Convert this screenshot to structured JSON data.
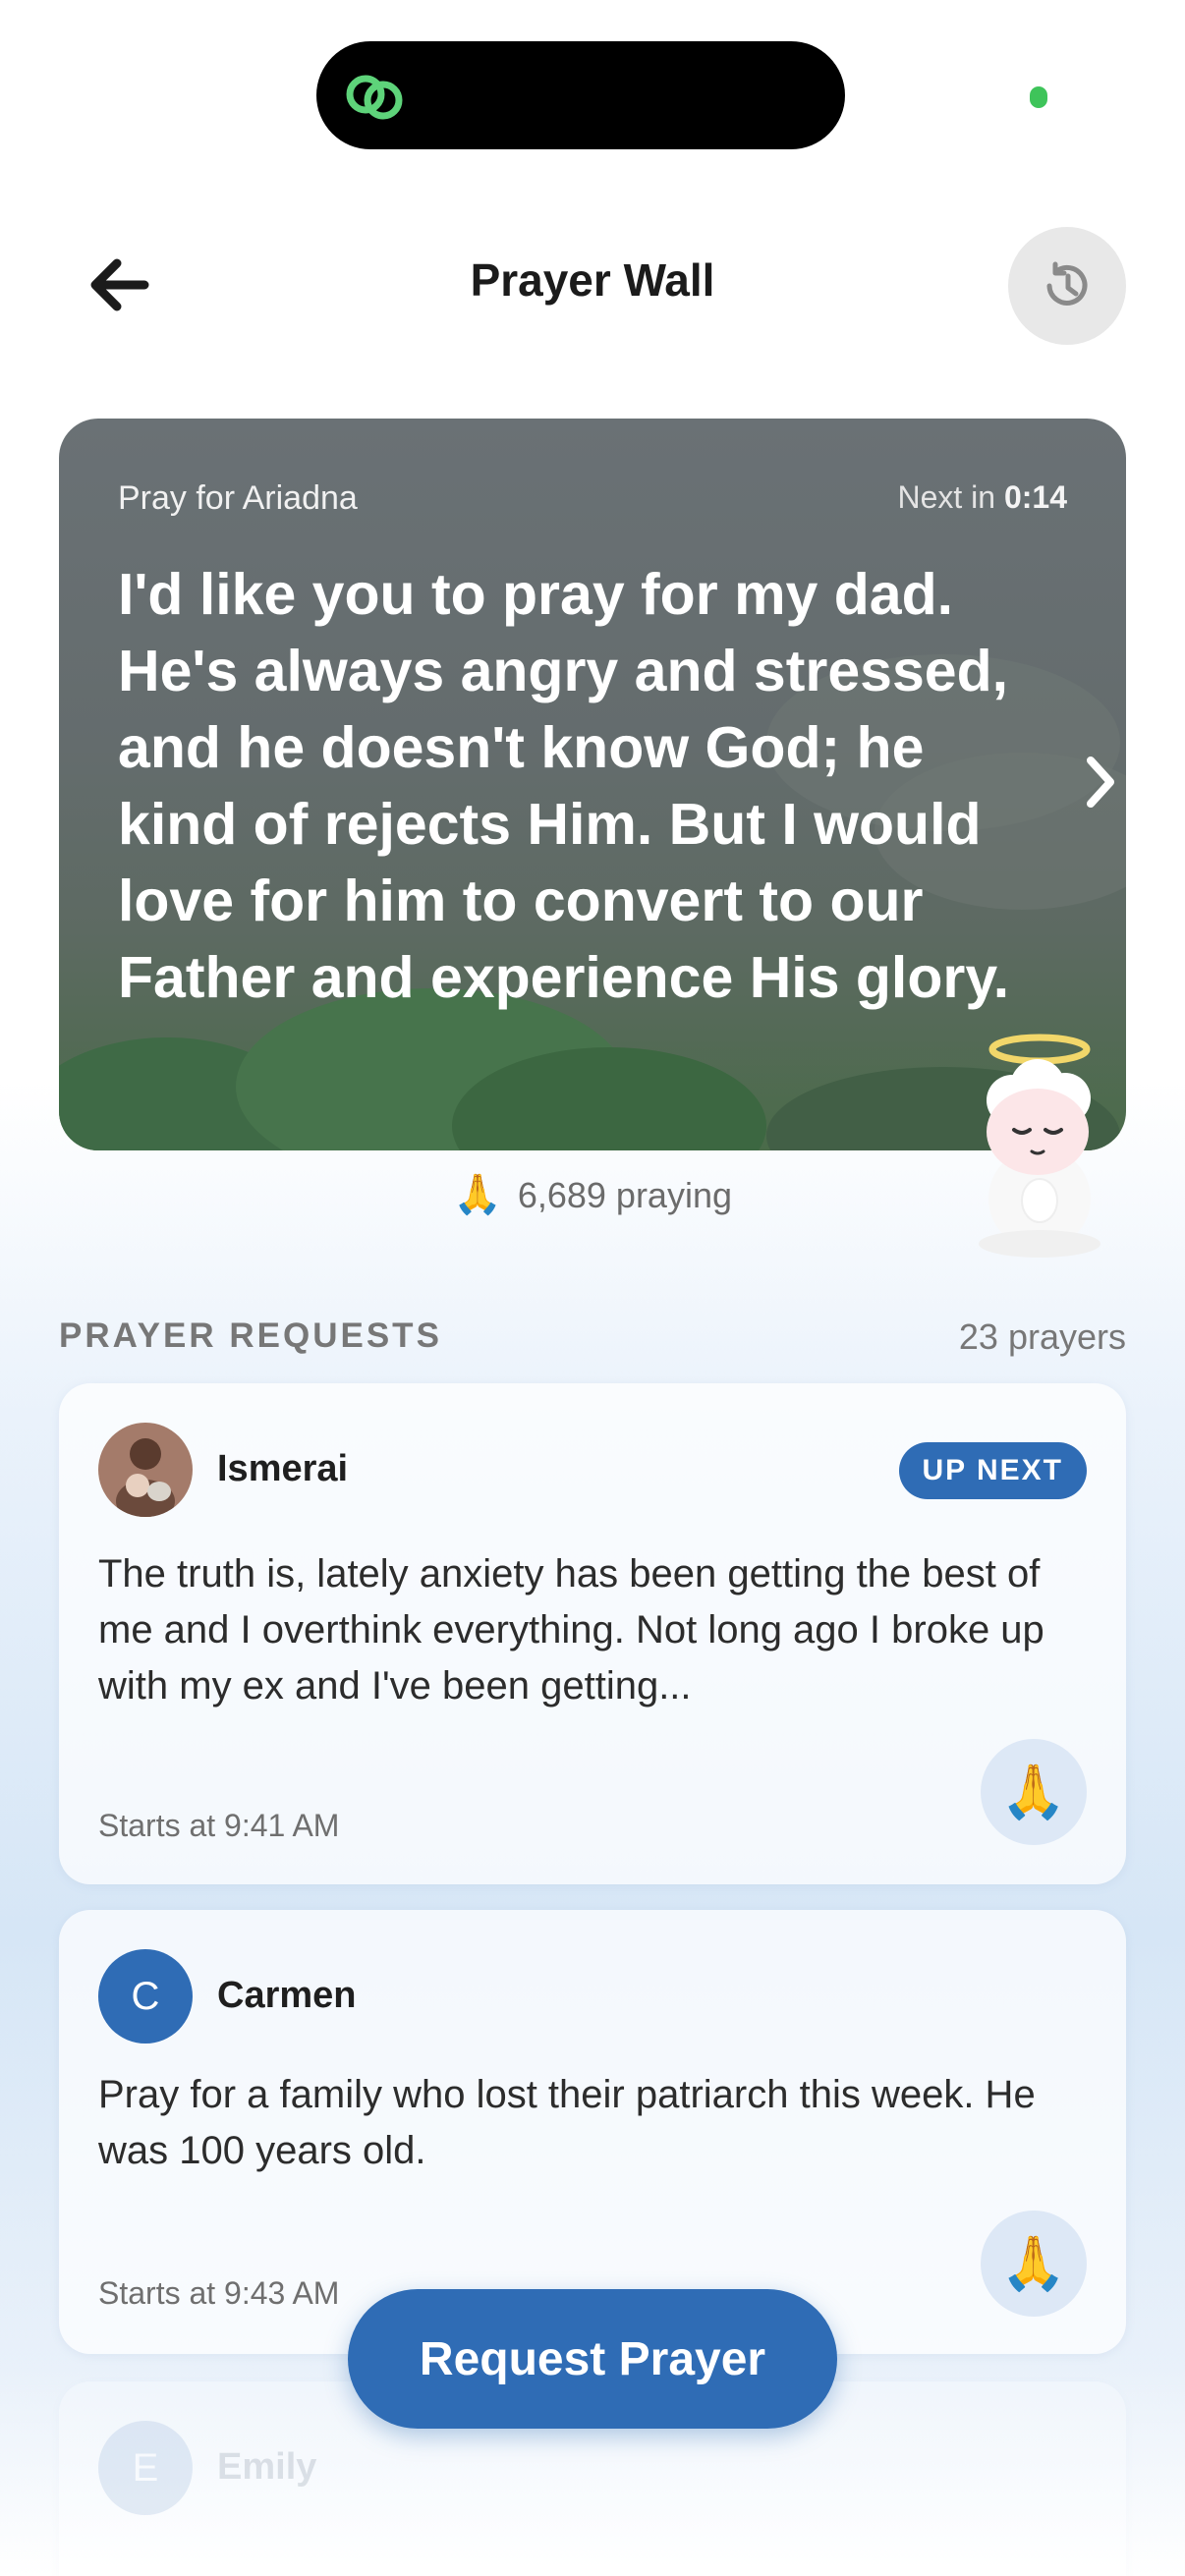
{
  "header": {
    "title": "Prayer Wall"
  },
  "featured": {
    "label": "Pray for Ariadna",
    "next_prefix": "Next in",
    "next_time": "0:14",
    "text": "I'd like you to pray for my dad. He's always angry and stressed, and he doesn't know God; he kind of rejects Him. But I would love for him to convert to our Father and experience His glory.",
    "praying_icon": "🙏",
    "praying_count": "6,689 praying"
  },
  "section": {
    "title": "PRAYER REQUESTS",
    "count": "23 prayers"
  },
  "requests": [
    {
      "name": "Ismerai",
      "badge": "UP NEXT",
      "text": "The truth is, lately anxiety has been getting the best of me and I overthink everything. Not long ago I broke up with my ex and I've been getting...",
      "starts": "Starts at 9:41 AM",
      "pray_icon": "🙏"
    },
    {
      "name": "Carmen",
      "initial": "C",
      "text": "Pray for a family who lost their patriarch this week. He was 100 years old.",
      "starts": "Starts at 9:43 AM",
      "pray_icon": "🙏"
    },
    {
      "name": "Emily",
      "initial": "E"
    }
  ],
  "actions": {
    "request_prayer": "Request Prayer"
  },
  "colors": {
    "accent": "#2f6cb5",
    "island_app": "#3ec45a"
  }
}
